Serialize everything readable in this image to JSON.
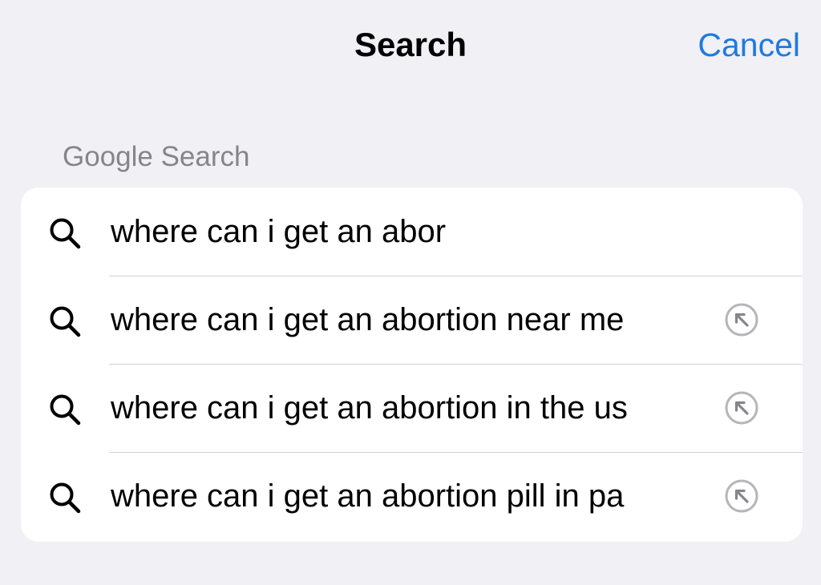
{
  "nav": {
    "title": "Search",
    "cancel_label": "Cancel"
  },
  "section": {
    "header": "Google Search"
  },
  "suggestions": [
    {
      "text": "where can i get an abor",
      "icon": "search-icon",
      "has_fill_arrow": false
    },
    {
      "text": "where can i get an abortion near me",
      "icon": "search-icon",
      "has_fill_arrow": true
    },
    {
      "text": "where can i get an abortion in the us",
      "icon": "search-icon",
      "has_fill_arrow": true
    },
    {
      "text": "where can i get an abortion pill in pa",
      "icon": "search-icon",
      "has_fill_arrow": true
    }
  ],
  "colors": {
    "accent": "#1f7ae0",
    "background": "#f0f0f5",
    "card": "#ffffff",
    "secondary_text": "#85858b",
    "separator": "#d1d1d6",
    "fill_icon": "#b5b5ba"
  }
}
